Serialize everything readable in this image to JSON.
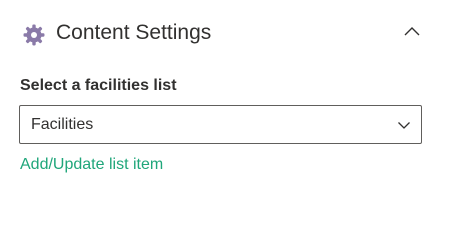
{
  "section": {
    "title": "Content Settings",
    "icon": "gear-icon",
    "collapse_icon": "chevron-up-icon"
  },
  "field": {
    "label": "Select a facilities list",
    "selected_value": "Facilities",
    "dropdown_icon": "chevron-down-icon"
  },
  "action": {
    "link_label": "Add/Update list item"
  },
  "colors": {
    "link": "#1fa67a",
    "gear_icon": "#8a7aa8",
    "text": "#323130",
    "border": "#605e5c"
  }
}
